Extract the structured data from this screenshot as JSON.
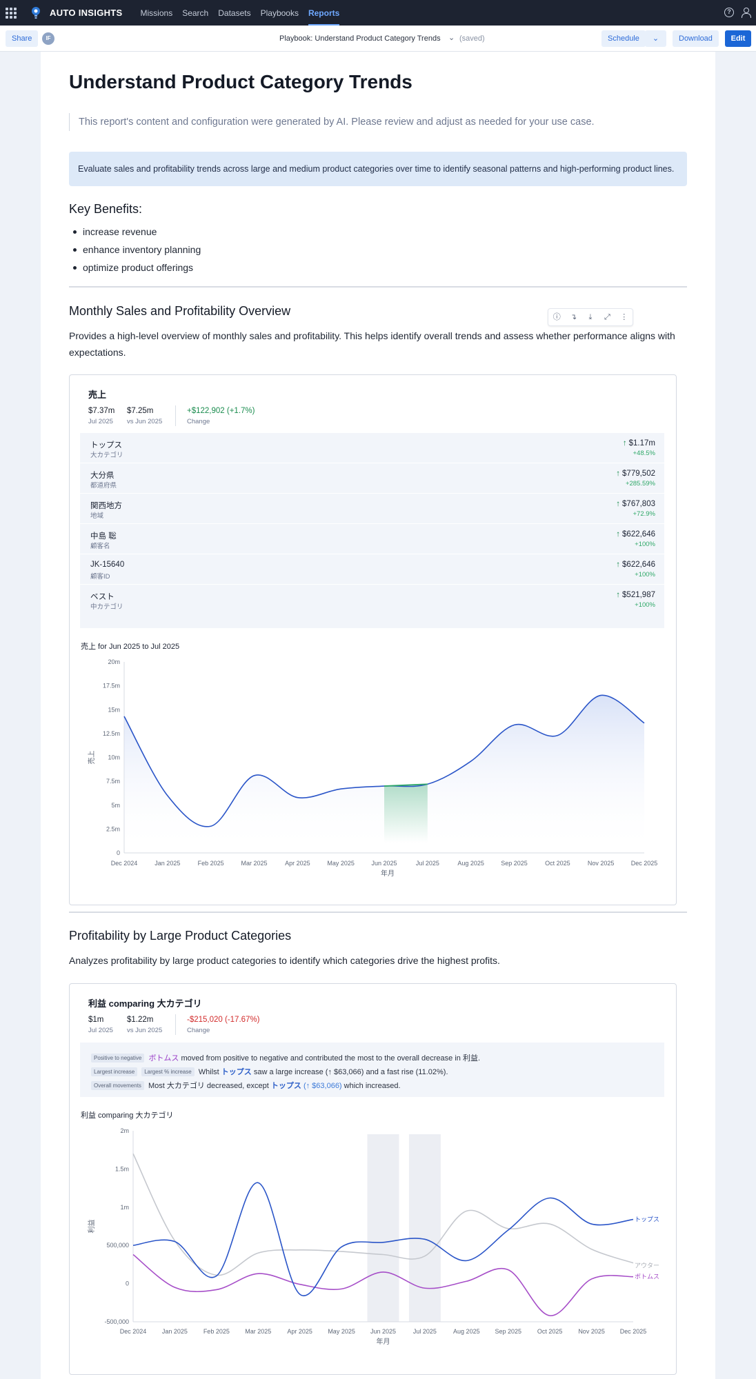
{
  "nav": {
    "brand": "AUTO INSIGHTS",
    "links": [
      "Missions",
      "Search",
      "Datasets",
      "Playbooks",
      "Reports"
    ],
    "active": "Reports",
    "help_icon": "help-circle-icon",
    "user_icon": "user-icon"
  },
  "subbar": {
    "share": "Share",
    "avatar": "IF",
    "playbook": "Playbook: Understand Product Category Trends",
    "saved": "(saved)",
    "schedule": "Schedule",
    "download": "Download",
    "edit": "Edit"
  },
  "report": {
    "title": "Understand Product Category Trends",
    "ai_note": "This report's content and configuration were generated by AI. Please review and adjust as needed for your use case.",
    "description": "Evaluate sales and profitability trends across large and medium product categories over time to identify seasonal patterns and high-performing product lines.",
    "benefits_heading": "Key Benefits:",
    "benefits": [
      "increase revenue",
      "enhance inventory planning",
      "optimize product offerings"
    ],
    "section1": {
      "heading": "Monthly Sales and Profitability Overview",
      "text": "Provides a high-level overview of monthly sales and profitability. This helps identify overall trends and assess whether performance aligns with expectations."
    },
    "section2": {
      "heading": "Profitability by Large Product Categories",
      "text": "Analyzes profitability by large product categories to identify which categories drive the highest profits."
    }
  },
  "card1": {
    "title": "売上",
    "current_value": "$7.37m",
    "current_label": "Jul 2025",
    "prev_value": "$7.25m",
    "prev_label": "vs Jun 2025",
    "change_value": "+$122,902 (+1.7%)",
    "change_label": "Change",
    "drivers": [
      {
        "name": "トップス",
        "category": "大カテゴリ",
        "value": "$1.17m",
        "pct": "+48.5%"
      },
      {
        "name": "大分県",
        "category": "都道府県",
        "value": "$779,502",
        "pct": "+285.59%"
      },
      {
        "name": "関西地方",
        "category": "地域",
        "value": "$767,803",
        "pct": "+72.9%"
      },
      {
        "name": "中島 聡",
        "category": "顧客名",
        "value": "$622,646",
        "pct": "+100%"
      },
      {
        "name": "JK-15640",
        "category": "顧客ID",
        "value": "$622,646",
        "pct": "+100%"
      },
      {
        "name": "ベスト",
        "category": "中カテゴリ",
        "value": "$521,987",
        "pct": "+100%"
      }
    ],
    "chart_title": "売上 for Jun 2025 to Jul 2025"
  },
  "card2": {
    "title": "利益 comparing 大カテゴリ",
    "current_value": "$1m",
    "current_label": "Jul 2025",
    "prev_value": "$1.22m",
    "prev_label": "vs Jun 2025",
    "change_value": "-$215,020 (-17.67%)",
    "change_label": "Change",
    "insights": {
      "line1_tag": "Positive to negative",
      "line1_entity": "ボトムス",
      "line1_text": "moved from positive to negative and contributed the most to the overall decrease in 利益.",
      "line2_tag1": "Largest increase",
      "line2_tag2": "Largest % increase",
      "line2_pre": "Whilst",
      "line2_entity": "トップス",
      "line2_text": "saw a large increase (↑ $63,066) and a fast rise (11.02%).",
      "line3_tag": "Overall movements",
      "line3_pre": "Most 大カテゴリ decreased, except",
      "line3_entity": "トップス",
      "line3_value": "(↑ $63,066)",
      "line3_text": "which increased."
    },
    "chart_title": "利益 comparing 大カテゴリ"
  },
  "chart_data": [
    {
      "type": "area",
      "title": "売上 for Jun 2025 to Jul 2025",
      "xlabel": "年月",
      "ylabel": "売上",
      "categories": [
        "Dec 2024",
        "Jan 2025",
        "Feb 2025",
        "Mar 2025",
        "Apr 2025",
        "May 2025",
        "Jun 2025",
        "Jul 2025",
        "Aug 2025",
        "Sep 2025",
        "Oct 2025",
        "Nov 2025",
        "Dec 2025"
      ],
      "values": [
        14.3,
        6.0,
        2.8,
        8.1,
        5.8,
        6.7,
        7.0,
        7.2,
        9.6,
        13.4,
        12.3,
        16.5,
        13.6
      ],
      "highlight_range": [
        "Jun 2025",
        "Jul 2025"
      ],
      "yticks": [
        "0",
        "2.5m",
        "5m",
        "7.5m",
        "10m",
        "12.5m",
        "15m",
        "17.5m",
        "20m"
      ],
      "ylim": [
        0,
        20
      ],
      "unit": "m",
      "colors": {
        "line": "#2a55c8",
        "highlight": "#2fa868"
      }
    },
    {
      "type": "line",
      "title": "利益 comparing 大カテゴリ",
      "xlabel": "年月",
      "ylabel": "利益",
      "categories": [
        "Dec 2024",
        "Jan 2025",
        "Feb 2025",
        "Mar 2025",
        "Apr 2025",
        "May 2025",
        "Jun 2025",
        "Jul 2025",
        "Aug 2025",
        "Sep 2025",
        "Oct 2025",
        "Nov 2025",
        "Dec 2025"
      ],
      "yticks": [
        "-500,000",
        "0",
        "500,000",
        "1m",
        "1.5m",
        "2m"
      ],
      "ylim": [
        -500000,
        2000000
      ],
      "highlight_columns": [
        "Jun 2025",
        "Jul 2025"
      ],
      "series": [
        {
          "name": "トップス",
          "color": "#2a55c8",
          "values": [
            500000,
            550000,
            100000,
            1320000,
            -140000,
            480000,
            540000,
            580000,
            300000,
            700000,
            1120000,
            780000,
            840000
          ]
        },
        {
          "name": "アウター",
          "color": "#c5c8ce",
          "values": [
            1700000,
            560000,
            110000,
            400000,
            440000,
            420000,
            380000,
            360000,
            950000,
            720000,
            780000,
            450000,
            270000
          ]
        },
        {
          "name": "ボトムス",
          "color": "#a64ec8",
          "values": [
            380000,
            -50000,
            -80000,
            130000,
            -10000,
            -70000,
            150000,
            -60000,
            30000,
            180000,
            -420000,
            60000,
            90000
          ]
        }
      ]
    }
  ]
}
